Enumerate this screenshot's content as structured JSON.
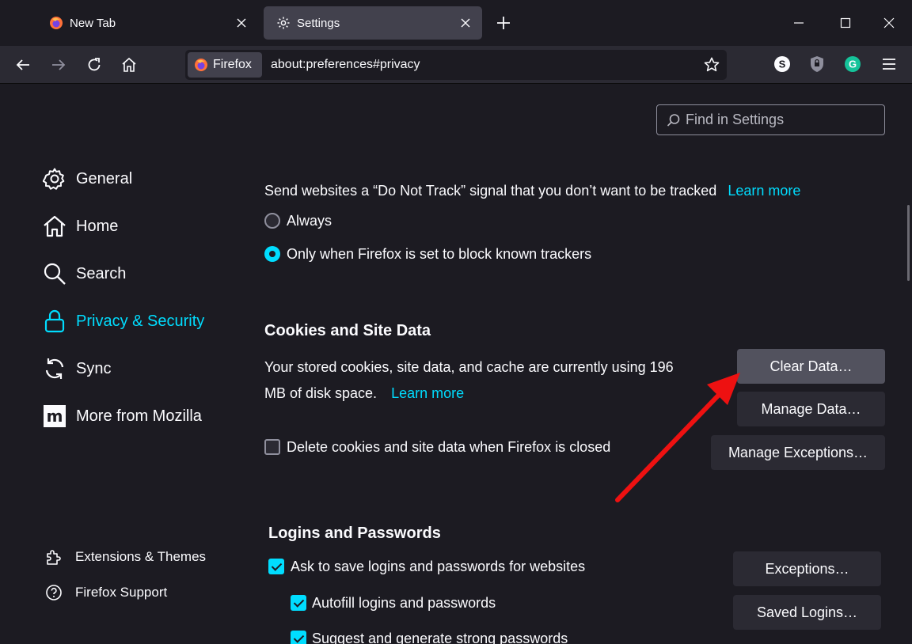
{
  "tabs": [
    {
      "label": "New Tab",
      "icon": "firefox-logo-icon",
      "active": false
    },
    {
      "label": "Settings",
      "icon": "gear-icon",
      "active": true
    }
  ],
  "toolbar": {
    "identity_label": "Firefox",
    "url": "about:preferences#privacy",
    "extensions": [
      "s-extension-icon",
      "shield-extension-icon",
      "grammarly-extension-icon"
    ]
  },
  "search": {
    "placeholder": "Find in Settings"
  },
  "sidebar": {
    "items": [
      {
        "label": "General",
        "icon": "gear-icon"
      },
      {
        "label": "Home",
        "icon": "home-icon"
      },
      {
        "label": "Search",
        "icon": "magnifier-icon"
      },
      {
        "label": "Privacy & Security",
        "icon": "lock-icon",
        "selected": true
      },
      {
        "label": "Sync",
        "icon": "sync-icon"
      },
      {
        "label": "More from Mozilla",
        "icon": "mozilla-m-icon"
      }
    ],
    "footer": [
      {
        "label": "Extensions & Themes",
        "icon": "puzzle-icon"
      },
      {
        "label": "Firefox Support",
        "icon": "help-icon"
      }
    ]
  },
  "dnt": {
    "description": "Send websites a “Do Not Track” signal that you don’t want to be tracked",
    "learn_more": "Learn more",
    "options": [
      {
        "label": "Always",
        "checked": false
      },
      {
        "label": "Only when Firefox is set to block known trackers",
        "checked": true
      }
    ]
  },
  "cookies": {
    "heading": "Cookies and Site Data",
    "usage_line1": "Your stored cookies, site data, and cache are currently using 196",
    "usage_line2": "MB of disk space.",
    "learn_more": "Learn more",
    "delete_on_close": {
      "label": "Delete cookies and site data when Firefox is closed",
      "checked": false
    },
    "buttons": {
      "clear": "Clear Data…",
      "manage": "Manage Data…",
      "exceptions": "Manage Exceptions…"
    }
  },
  "logins": {
    "heading": "Logins and Passwords",
    "ask_to_save": {
      "label": "Ask to save logins and passwords for websites",
      "checked": true
    },
    "autofill": {
      "label": "Autofill logins and passwords",
      "checked": true
    },
    "suggest": {
      "label": "Suggest and generate strong passwords",
      "checked": true
    },
    "buttons": {
      "exceptions": "Exceptions…",
      "saved": "Saved Logins…"
    }
  },
  "colors": {
    "accent": "#00ddff",
    "background": "#1c1b22",
    "annotation_arrow": "#ee1111"
  }
}
